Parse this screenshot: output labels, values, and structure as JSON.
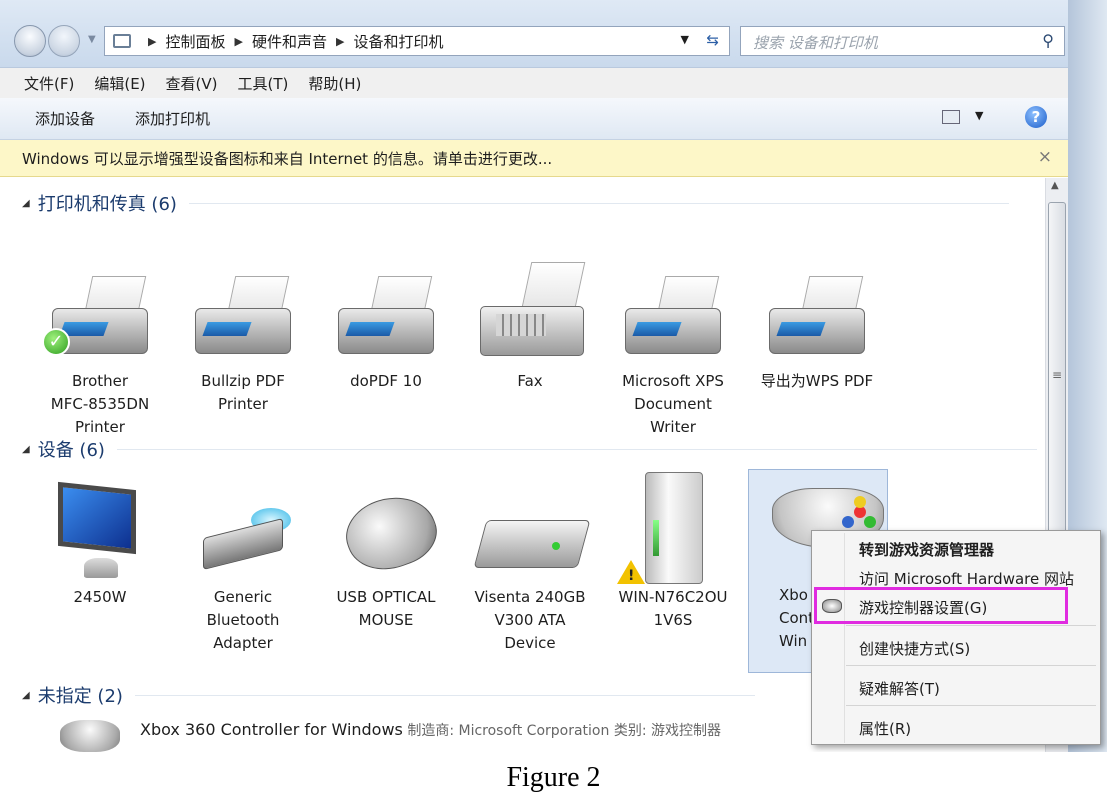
{
  "address_bar": {
    "breadcrumbs": [
      "控制面板",
      "硬件和声音",
      "设备和打印机"
    ],
    "search_placeholder": "搜索 设备和打印机"
  },
  "menu": [
    "文件(F)",
    "编辑(E)",
    "查看(V)",
    "工具(T)",
    "帮助(H)"
  ],
  "toolbar": {
    "add_device": "添加设备",
    "add_printer": "添加打印机"
  },
  "infobar": {
    "text": "Windows 可以显示增强型设备图标和来自 Internet 的信息。请单击进行更改...",
    "close": "×"
  },
  "groups": {
    "printers": {
      "title": "打印机和传真 (6)",
      "items": [
        "Brother\nMFC-8535DN\nPrinter",
        "Bullzip PDF\nPrinter",
        "doPDF 10",
        "Fax",
        "Microsoft XPS\nDocument\nWriter",
        "导出为WPS PDF"
      ]
    },
    "devices": {
      "title": "设备 (6)",
      "items": [
        "2450W",
        "Generic\nBluetooth\nAdapter",
        "USB OPTICAL\nMOUSE",
        "Visenta 240GB\nV300 ATA\nDevice",
        "WIN-N76C2OU\n1V6S",
        "Xbo\nContr\nWin"
      ]
    },
    "unspecified": {
      "title": "未指定 (2)",
      "row_name": "Xbox 360 Controller for Windows",
      "row_meta": " 制造商: Microsoft Corporation  类别: 游戏控制器"
    }
  },
  "context_menu": {
    "items": [
      "转到游戏资源管理器",
      "访问 Microsoft Hardware 网站",
      "游戏控制器设置(G)",
      "创建快捷方式(S)",
      "疑难解答(T)",
      "属性(R)"
    ],
    "highlight_color": "#e02be0"
  },
  "caption": "Figure 2"
}
